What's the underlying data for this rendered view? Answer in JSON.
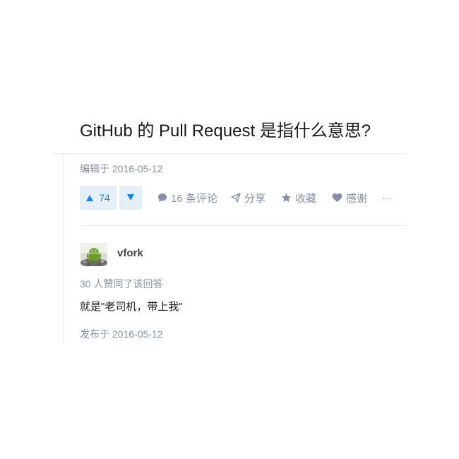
{
  "question": {
    "title": "GitHub 的 Pull Request 是指什么意思?"
  },
  "answer_top": {
    "edit_time": "编辑于 2016-05-12",
    "vote_count": "74",
    "comments_label": "16 条评论",
    "share_label": "分享",
    "collect_label": "收藏",
    "thanks_label": "感谢",
    "more_label": "···"
  },
  "answer": {
    "author_name": "vfork",
    "vote_summary": "30 人赞同了该回答",
    "content": "就是\"老司机，带上我\"",
    "publish_time": "发布于 2016-05-12"
  },
  "colors": {
    "accent": "#0f88eb",
    "vote_bg": "#e5eff9",
    "meta": "#8590a6"
  }
}
